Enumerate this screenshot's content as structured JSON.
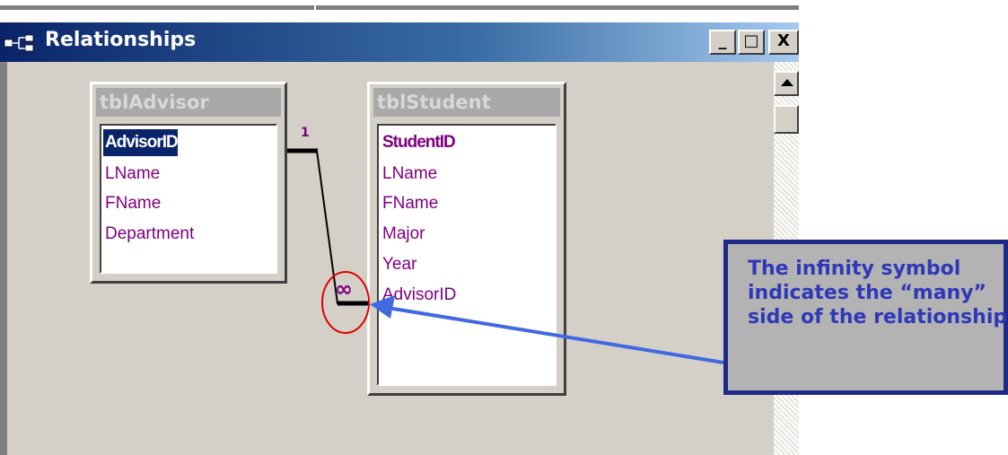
{
  "window": {
    "title": "Relationships",
    "buttons": {
      "minimize": "_",
      "maximize": "□",
      "close": "X"
    }
  },
  "tables": [
    {
      "name": "tblAdvisor",
      "fields": [
        "AdvisorID",
        "LName",
        "FName",
        "Department"
      ],
      "key_field": "AdvisorID",
      "selected_field": "AdvisorID"
    },
    {
      "name": "tblStudent",
      "fields": [
        "StudentID",
        "LName",
        "FName",
        "Major",
        "Year",
        "AdvisorID"
      ],
      "key_field": "StudentID"
    }
  ],
  "relationship": {
    "one_side_label": "1",
    "many_side_label": "∞"
  },
  "callout": {
    "text": "The infinity symbol indicates the “many” side of the relationship"
  },
  "colors": {
    "title_gradient_start": "#0a246a",
    "field_text": "#800080",
    "callout_border": "#1f2a86",
    "callout_text": "#2f38b8",
    "arrow": "#4169e1",
    "highlight_circle": "#e00000"
  }
}
